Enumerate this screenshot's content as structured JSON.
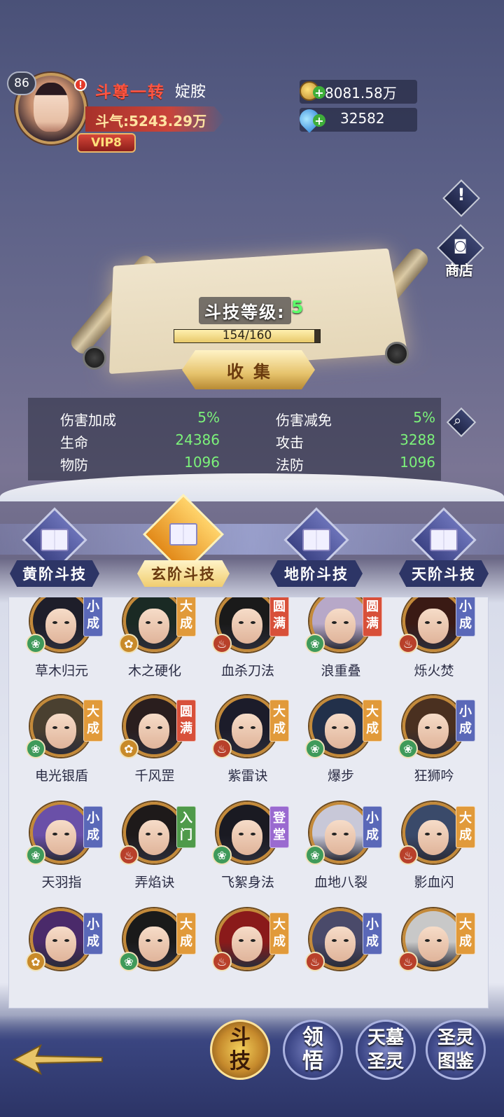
{
  "player": {
    "level": "86",
    "alert": "!",
    "rank_title": "斗尊一转",
    "name": "婝胺",
    "power": "斗气:5243.29万",
    "vip": "VIP8"
  },
  "resources": {
    "gold": "8081.58万",
    "gem": "32582"
  },
  "side_buttons": {
    "info": "!",
    "shop_label": "商店"
  },
  "scroll": {
    "level_label": "斗技等级:",
    "level_value": "5",
    "progress_text": "154/160",
    "progress_current": 154,
    "progress_max": 160,
    "collect_label": "收集"
  },
  "stats": [
    {
      "label": "伤害加成",
      "value": "5%"
    },
    {
      "label": "伤害减免",
      "value": "5%"
    },
    {
      "label": "生命",
      "value": "24386"
    },
    {
      "label": "攻击",
      "value": "3288"
    },
    {
      "label": "物防",
      "value": "1096"
    },
    {
      "label": "法防",
      "value": "1096"
    }
  ],
  "tabs": [
    {
      "label": "黄阶斗技",
      "active": false
    },
    {
      "label": "玄阶斗技",
      "active": true
    },
    {
      "label": "地阶斗技",
      "active": false
    },
    {
      "label": "天阶斗技",
      "active": false
    }
  ],
  "skills": [
    {
      "name": "草木归元",
      "rank": [
        "小",
        "成"
      ],
      "rank_color": "#5a68b8",
      "element": "green",
      "hair": "#1e1e2a"
    },
    {
      "name": "木之硬化",
      "rank": [
        "大",
        "成"
      ],
      "rank_color": "#e19a3a",
      "element": "gold",
      "hair": "#1a2a24"
    },
    {
      "name": "血杀刀法",
      "rank": [
        "圆",
        "满"
      ],
      "rank_color": "#d8503a",
      "element": "red",
      "hair": "#1a1a1a"
    },
    {
      "name": "浪重叠",
      "rank": [
        "圆",
        "满"
      ],
      "rank_color": "#d8503a",
      "element": "green",
      "hair": "#b7a8c8"
    },
    {
      "name": "烁火焚",
      "rank": [
        "小",
        "成"
      ],
      "rank_color": "#5a68b8",
      "element": "red",
      "hair": "#3a1a14"
    },
    {
      "name": "电光银盾",
      "rank": [
        "大",
        "成"
      ],
      "rank_color": "#e19a3a",
      "element": "green",
      "hair": "#4a4030"
    },
    {
      "name": "千风罡",
      "rank": [
        "圆",
        "满"
      ],
      "rank_color": "#d8503a",
      "element": "gold",
      "hair": "#2a1e1e"
    },
    {
      "name": "紫雷诀",
      "rank": [
        "大",
        "成"
      ],
      "rank_color": "#e19a3a",
      "element": "red",
      "hair": "#1c1c2a"
    },
    {
      "name": "爆步",
      "rank": [
        "大",
        "成"
      ],
      "rank_color": "#e19a3a",
      "element": "green",
      "hair": "#22304a"
    },
    {
      "name": "狂狮吟",
      "rank": [
        "小",
        "成"
      ],
      "rank_color": "#5a68b8",
      "element": "green",
      "hair": "#4a3020"
    },
    {
      "name": "天羽指",
      "rank": [
        "小",
        "成"
      ],
      "rank_color": "#5a68b8",
      "element": "green",
      "hair": "#6a50a8"
    },
    {
      "name": "弄焰诀",
      "rank": [
        "入",
        "门"
      ],
      "rank_color": "#4f9a4a",
      "element": "red",
      "hair": "#1e1a1a"
    },
    {
      "name": "飞絮身法",
      "rank": [
        "登",
        "堂"
      ],
      "rank_color": "#9a6ad0",
      "element": "green",
      "hair": "#1a1a22"
    },
    {
      "name": "血地八裂",
      "rank": [
        "小",
        "成"
      ],
      "rank_color": "#5a68b8",
      "element": "green",
      "hair": "#c8c8d8"
    },
    {
      "name": "影血闪",
      "rank": [
        "大",
        "成"
      ],
      "rank_color": "#e19a3a",
      "element": "red",
      "hair": "#3a4a6a"
    },
    {
      "name": "",
      "rank": [
        "小",
        "成"
      ],
      "rank_color": "#5a68b8",
      "element": "gold",
      "hair": "#4a2a6a"
    },
    {
      "name": "",
      "rank": [
        "大",
        "成"
      ],
      "rank_color": "#e19a3a",
      "element": "green",
      "hair": "#1a1a1a"
    },
    {
      "name": "",
      "rank": [
        "大",
        "成"
      ],
      "rank_color": "#e19a3a",
      "element": "red",
      "hair": "#8a1a1a"
    },
    {
      "name": "",
      "rank": [
        "小",
        "成"
      ],
      "rank_color": "#5a68b8",
      "element": "red",
      "hair": "#4a4a6a"
    },
    {
      "name": "",
      "rank": [
        "大",
        "成"
      ],
      "rank_color": "#e19a3a",
      "element": "red",
      "hair": "#c8c8c8"
    }
  ],
  "bottom_nav": [
    {
      "label_top": "斗",
      "label_bottom": "技",
      "active": true
    },
    {
      "label_top": "领",
      "label_bottom": "悟",
      "active": false
    },
    {
      "label_top": "天墓",
      "label_bottom": "圣灵",
      "active": false
    },
    {
      "label_top": "圣灵",
      "label_bottom": "图鉴",
      "active": false
    }
  ],
  "colors": {
    "stat_value": "#7cf27a",
    "rank_title": "#ff5542",
    "level_value": "#5cff6a"
  }
}
